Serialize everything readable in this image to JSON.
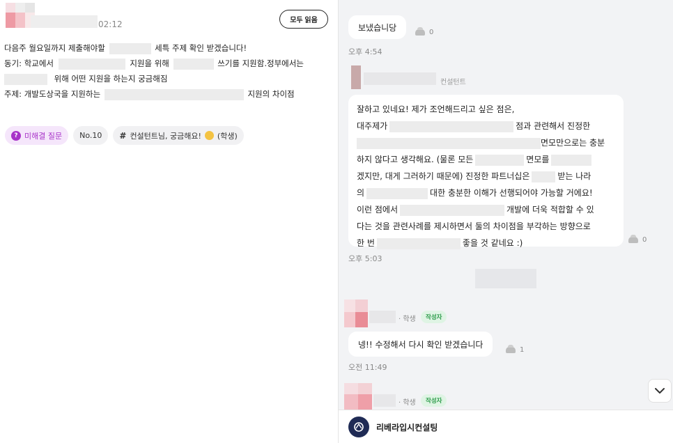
{
  "post": {
    "time": "02:12",
    "read_all_label": "모두 읽음",
    "lines": [
      [
        "다음주 월요일까지 제출해야할",
        "세특 주제 확인 받겠습니다!"
      ],
      [
        "동기: 학교에서",
        "지원을 위해",
        "쓰기를 지원함.정부에서는"
      ],
      [
        "위해 어떤 지원을 하는지 궁금해짐"
      ],
      [
        "주제: 개발도상국을 지원하는",
        "지원의 차이점"
      ]
    ],
    "tags": {
      "unsolved": "미해결 질문",
      "number": "No.10",
      "hashtag": "컨설턴트님, 궁금해요!",
      "hashtag_suffix": "(학생)"
    }
  },
  "chat": {
    "messages": [
      {
        "text": "보냈습니당",
        "reaction_count": "0",
        "time": "오후 4:54"
      },
      {
        "sender_role": "컨설턴트",
        "lines": [
          [
            "잘하고 있네요! 제가 조언해드리고 싶은 점은,"
          ],
          [
            "대주제가",
            "점과 관련해서 진정한"
          ],
          [
            "",
            "면모만으로는 충분"
          ],
          [
            "하지 않다고 생각해요. (물론 모든",
            "면모를"
          ],
          [
            "겠지만, 대게 그러하기 때문에) 진정한 파트너십은",
            "받는 나라"
          ],
          [
            "의",
            "대한 충분한 이해가 선행되어야 가능할 거에요!"
          ],
          [
            "이런 점에서",
            "개발에 더욱 적합할 수 있"
          ],
          [
            "다는 것을 관련사례를 제시하면서 둘의 차이점을 부각하는 방향으로"
          ],
          [
            "한 번",
            "좋을 것 같네요 :)"
          ]
        ],
        "reaction_count": "0",
        "time": "오후 5:03"
      },
      {
        "sender_role": "· 학생",
        "author_badge": "작성자",
        "text": "넹!! 수정해서 다시 확인 받겠습니다",
        "reaction_count": "1",
        "time": "오전 11:49"
      },
      {
        "sender_role": "· 학생",
        "author_badge": "작성자"
      }
    ]
  },
  "footer": {
    "brand": "리베라입시컨설팅"
  },
  "icons": [
    "question-icon",
    "hash-icon",
    "emoji-icon",
    "reaction-icon",
    "chevron-down-icon",
    "brand-logo-icon"
  ],
  "colors": {
    "accent_purple": "#a833c9",
    "author_green": "#2e9c4b",
    "chat_bg": "#f2f3f5",
    "brand_navy": "#1f2b55"
  }
}
